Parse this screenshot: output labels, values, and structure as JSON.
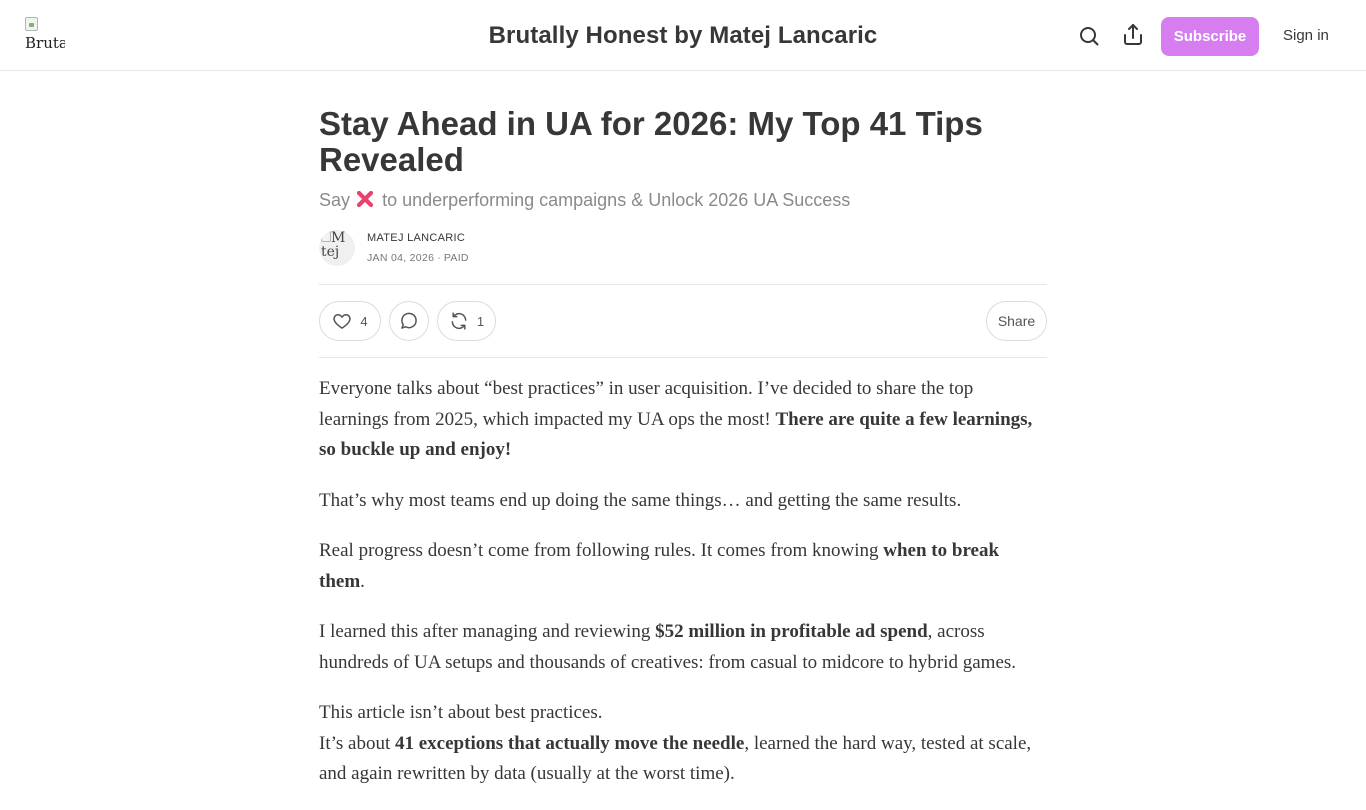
{
  "header": {
    "logo_alt": "Bruta",
    "site_title": "Brutally Honest by Matej Lancaric",
    "subscribe_label": "Subscribe",
    "signin_label": "Sign in",
    "icons": [
      "search-icon",
      "share-icon"
    ]
  },
  "post": {
    "title": "Stay Ahead in UA for 2026: My Top 41 Tips Revealed",
    "subtitle_before": "Say",
    "subtitle_emoji": "cross-mark-icon",
    "subtitle_after": "to underperforming campaigns & Unlock 2026 UA Success",
    "author": "MATEJ LANCARIC",
    "avatar_alt": "M tej",
    "date": "JAN 04, 2026",
    "access": "PAID",
    "meta_separator": "∙"
  },
  "actions": {
    "likes": "4",
    "restacks": "1",
    "share_label": "Share"
  },
  "body": {
    "p1_a": "Everyone talks about “best practices” in user acquisition. I’ve decided to share the top learnings from 2025, which impacted my UA ops the most! ",
    "p1_b": "There are quite a few learnings, so buckle up and enjoy!",
    "p2": "That’s why most teams end up doing the same things… and getting the same results.",
    "p3_a": "Real progress doesn’t come from following rules. It comes from knowing ",
    "p3_b": "when to break them",
    "p3_c": ".",
    "p4_a": "I learned this after managing and reviewing ",
    "p4_b": "$52 million in profitable ad spend",
    "p4_c": ", across hundreds of UA setups and thousands of creatives: from casual to midcore to hybrid games.",
    "p5_line1": "This article isn’t about best practices.",
    "p5_a": "It’s about ",
    "p5_b": "41 exceptions that actually move the needle",
    "p5_c": ", learned the hard way, tested at scale, and again rewritten by data (usually at the worst time)."
  }
}
